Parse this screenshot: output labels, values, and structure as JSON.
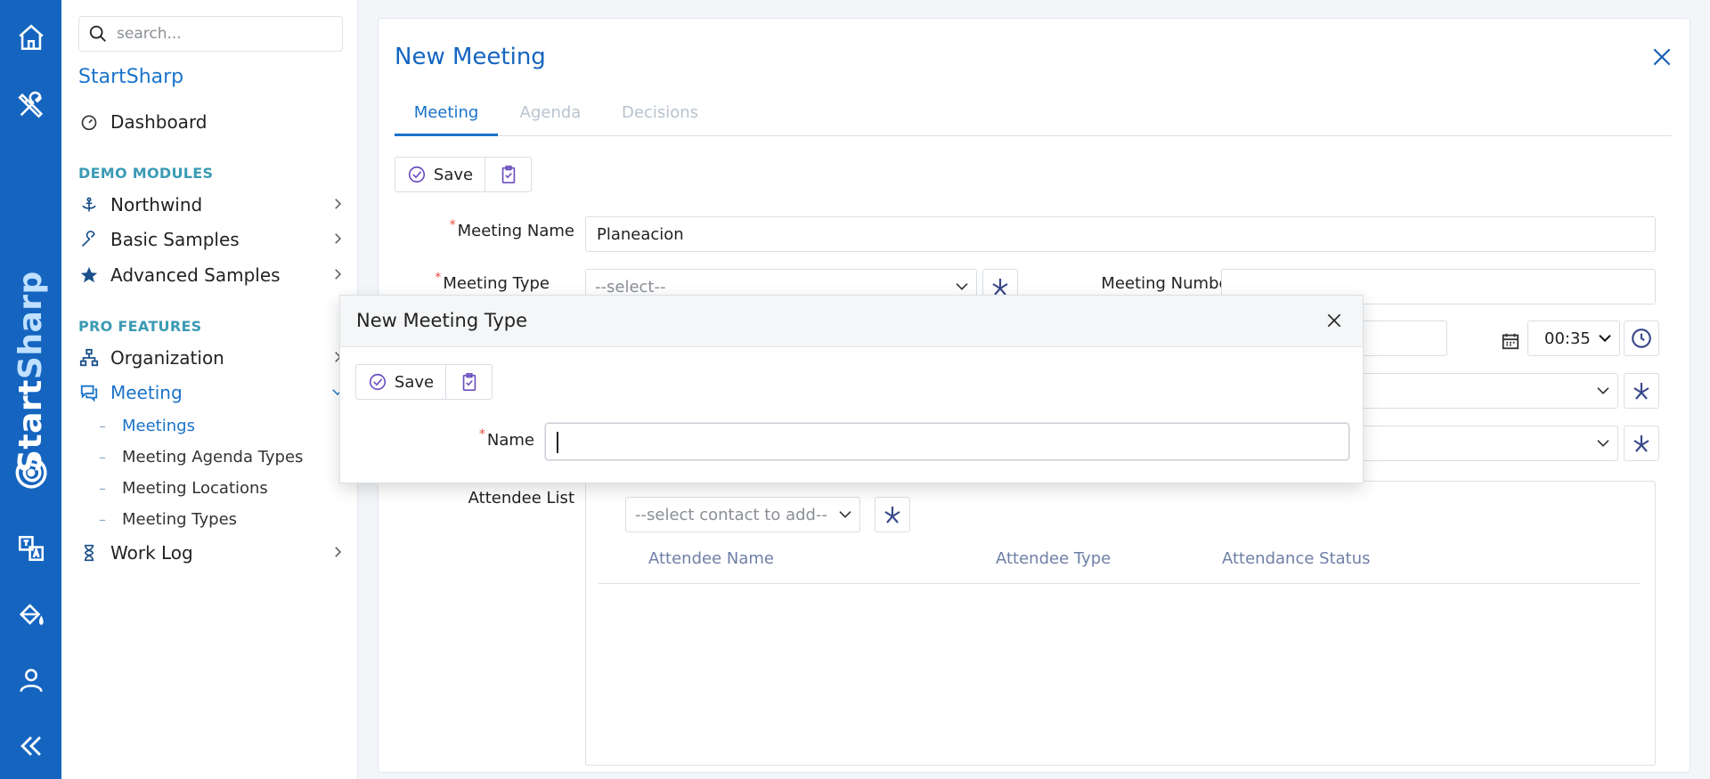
{
  "rail": {
    "icons": [
      "home-icon",
      "tools-icon",
      "translate-icon",
      "paint-bucket-icon",
      "user-icon",
      "collapse-icon"
    ],
    "brand_start": "Start",
    "brand_sharp": "Sharp",
    "color": "#1565c0"
  },
  "sidebar": {
    "search_placeholder": "search...",
    "title": "StartSharp",
    "dashboard": "Dashboard",
    "section_demo": "DEMO MODULES",
    "northwind": "Northwind",
    "basic_samples": "Basic Samples",
    "advanced_samples": "Advanced Samples",
    "section_pro": "PRO FEATURES",
    "organization": "Organization",
    "meeting": "Meeting",
    "sub_items": [
      "Meetings",
      "Meeting Agenda Types",
      "Meeting Locations",
      "Meeting Types"
    ],
    "work_log": "Work Log"
  },
  "card": {
    "title": "New Meeting",
    "tabs": [
      "Meeting",
      "Agenda",
      "Decisions"
    ],
    "save_label": "Save",
    "meeting_name_label": "Meeting Name",
    "meeting_name_value": "Planeacion",
    "meeting_type_label": "Meeting Type",
    "meeting_type_value": "--select--",
    "meeting_number_label": "Meeting Number",
    "time_value": "00:35",
    "attendee_list_label": "Attendee List",
    "contact_select_placeholder": "--select contact to add--",
    "columns": [
      "Attendee Name",
      "Attendee Type",
      "Attendance Status"
    ]
  },
  "dialog": {
    "title": "New Meeting Type",
    "save_label": "Save",
    "name_label": "Name",
    "name_value": ""
  }
}
